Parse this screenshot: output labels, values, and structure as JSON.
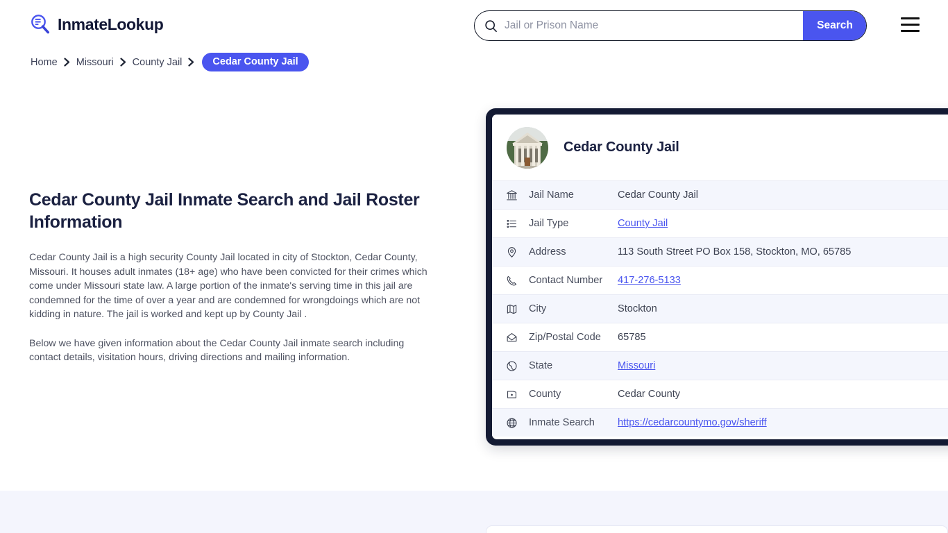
{
  "header": {
    "brand_name": "InmateLookup",
    "brand_icon": "magnifier-list-logo-icon",
    "search": {
      "placeholder": "Jail or Prison Name",
      "value": "",
      "button_label": "Search",
      "icon": "search-icon"
    },
    "menu_icon": "hamburger-menu-icon"
  },
  "breadcrumb": {
    "items": [
      {
        "label": "Home",
        "current": false
      },
      {
        "label": "Missouri",
        "current": false
      },
      {
        "label": "County Jail",
        "current": false
      },
      {
        "label": "Cedar County Jail",
        "current": true
      }
    ],
    "separator_icon": "chevron-right-icon"
  },
  "main": {
    "title": "Cedar County Jail Inmate Search and Jail Roster Information",
    "paragraph_1": "Cedar County Jail is a high security County Jail located in city of Stockton, Cedar County, Missouri. It houses adult inmates (18+ age) who have been convicted for their crimes which come under Missouri state law. A large portion of the inmate's serving time in this jail are condemned for the time of over a year and are condemned for wrongdoings which are not kidding in nature. The jail is worked and kept up by County Jail .",
    "paragraph_2": "Below we have given information about the Cedar County Jail inmate search including contact details, visitation hours, driving directions and mailing information."
  },
  "card": {
    "avatar_icon": "courthouse-photo",
    "title": "Cedar County Jail",
    "rows": [
      {
        "icon": "bank-icon",
        "label": "Jail Name",
        "value": "Cedar County Jail",
        "is_link": false
      },
      {
        "icon": "list-icon",
        "label": "Jail Type",
        "value": "County Jail",
        "is_link": true
      },
      {
        "icon": "map-pin-icon",
        "label": "Address",
        "value": "113 South Street PO Box 158, Stockton, MO, 65785",
        "is_link": false
      },
      {
        "icon": "phone-icon",
        "label": "Contact Number",
        "value": "417-276-5133",
        "is_link": true
      },
      {
        "icon": "map-icon",
        "label": "City",
        "value": "Stockton",
        "is_link": false
      },
      {
        "icon": "envelope-icon",
        "label": "Zip/Postal Code",
        "value": "65785",
        "is_link": false
      },
      {
        "icon": "globe-state-icon",
        "label": "State",
        "value": "Missouri",
        "is_link": true
      },
      {
        "icon": "county-icon",
        "label": "County",
        "value": "Cedar County",
        "is_link": false
      },
      {
        "icon": "globe-icon",
        "label": "Inmate Search",
        "value": "https://cedarcountymo.gov/sheriff",
        "is_link": true
      }
    ]
  },
  "colors": {
    "accent": "#4a55ef",
    "card_border": "#131a33",
    "row_stripe": "#f4f6fd",
    "band": "#f4f5fd",
    "heading": "#1b2141"
  }
}
